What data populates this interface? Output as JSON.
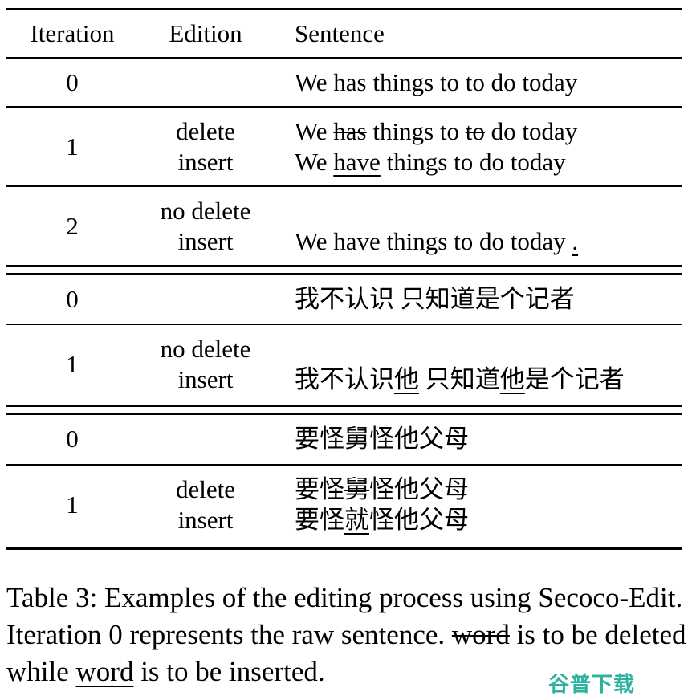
{
  "table": {
    "headers": {
      "iteration": "Iteration",
      "edition": "Edition",
      "sentence": "Sentence"
    },
    "groups": [
      {
        "rows": [
          {
            "iteration": "0",
            "edition": [],
            "sentence": [
              [
                {
                  "t": "We has things to to do today"
                }
              ]
            ]
          },
          {
            "iteration": "1",
            "edition": [
              "delete",
              "insert"
            ],
            "sentence": [
              [
                {
                  "t": "We "
                },
                {
                  "t": "has",
                  "s": "del"
                },
                {
                  "t": " things to "
                },
                {
                  "t": "to",
                  "s": "del"
                },
                {
                  "t": " do today"
                }
              ],
              [
                {
                  "t": "We "
                },
                {
                  "t": "have",
                  "s": "ins"
                },
                {
                  "t": " things to do today"
                }
              ]
            ]
          },
          {
            "iteration": "2",
            "edition": [
              "no delete",
              "insert"
            ],
            "sentence": [
              [
                {
                  "t": ""
                }
              ],
              [
                {
                  "t": "We have things to do today "
                },
                {
                  "t": ".",
                  "s": "ins"
                }
              ]
            ]
          }
        ]
      },
      {
        "rows": [
          {
            "iteration": "0",
            "edition": [],
            "sentence": [
              [
                {
                  "t": "我不认识 只知道是个记者"
                }
              ]
            ]
          },
          {
            "iteration": "1",
            "edition": [
              "no delete",
              "insert"
            ],
            "sentence": [
              [
                {
                  "t": ""
                }
              ],
              [
                {
                  "t": "我不认识"
                },
                {
                  "t": "他",
                  "s": "ins"
                },
                {
                  "t": " 只知道"
                },
                {
                  "t": "他",
                  "s": "ins"
                },
                {
                  "t": "是个记者"
                }
              ]
            ]
          }
        ]
      },
      {
        "rows": [
          {
            "iteration": "0",
            "edition": [],
            "sentence": [
              [
                {
                  "t": "要怪舅怪他父母"
                }
              ]
            ]
          },
          {
            "iteration": "1",
            "edition": [
              "delete",
              "insert"
            ],
            "sentence": [
              [
                {
                  "t": "要怪"
                },
                {
                  "t": "舅",
                  "s": "del"
                },
                {
                  "t": "怪他父母"
                }
              ],
              [
                {
                  "t": "要怪"
                },
                {
                  "t": "就",
                  "s": "ins"
                },
                {
                  "t": "怪他父母"
                }
              ]
            ]
          }
        ]
      }
    ]
  },
  "caption": {
    "part1": "Table 3: Examples of the editing process using Secoco-Edit. Iteration 0 represents the raw sentence. ",
    "deleted_example": "word",
    "part2": " is to be deleted while ",
    "inserted_example": "word",
    "part3": " is to be inserted."
  },
  "watermark": "谷普下载"
}
